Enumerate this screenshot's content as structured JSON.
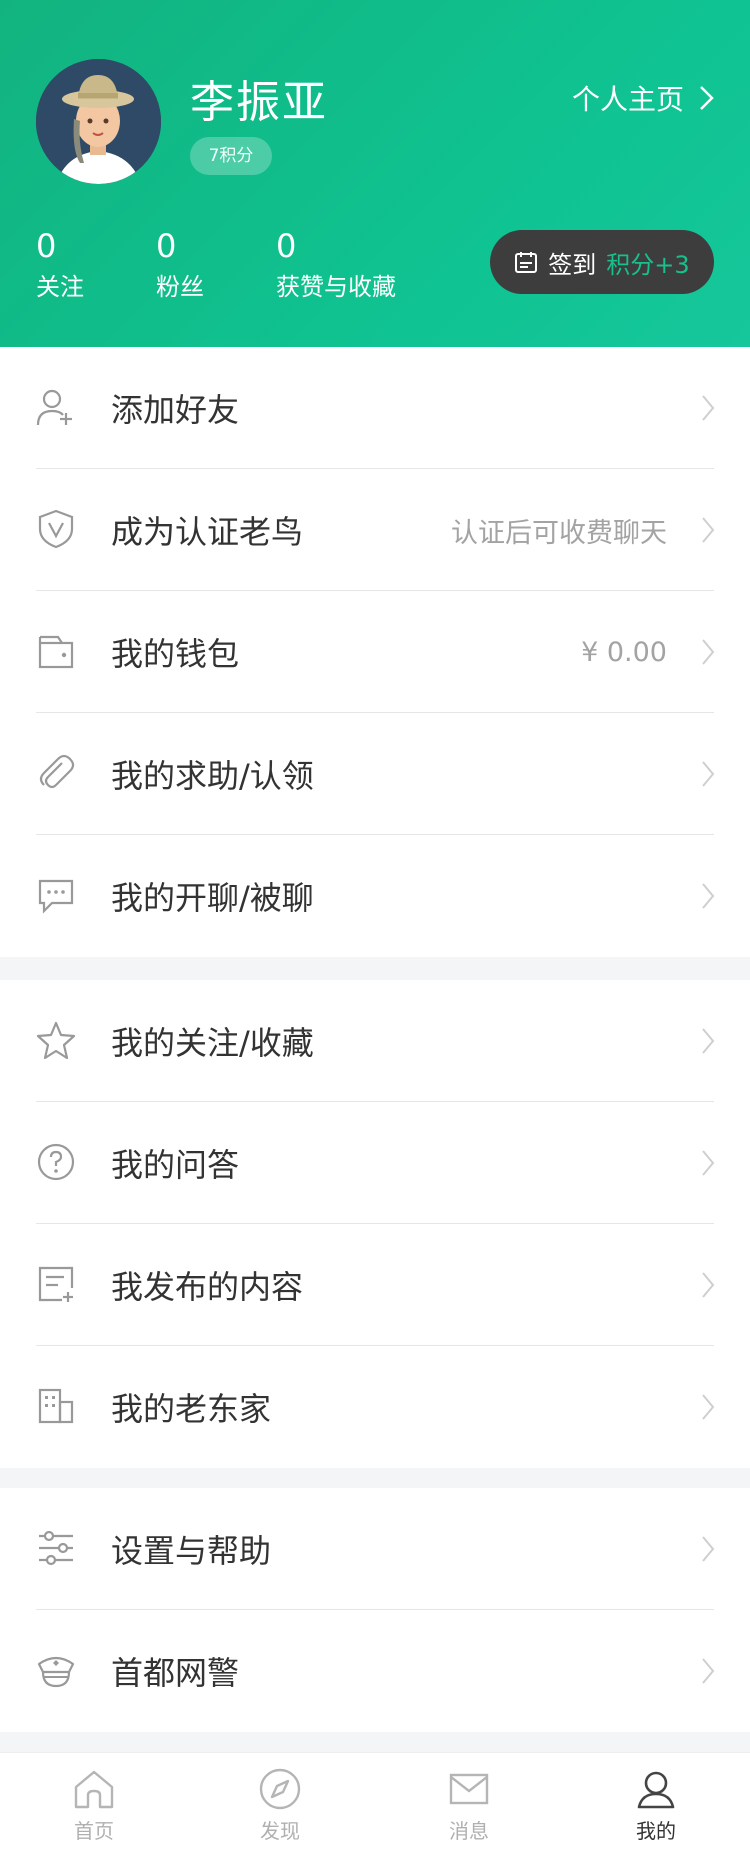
{
  "profile": {
    "name": "李振亚",
    "points_badge": "7积分",
    "homepage_link": "个人主页",
    "stats": [
      {
        "count": "0",
        "label": "关注"
      },
      {
        "count": "0",
        "label": "粉丝"
      },
      {
        "count": "0",
        "label": "获赞与收藏"
      }
    ],
    "checkin": {
      "label": "签到",
      "reward": "积分+3"
    }
  },
  "section1": [
    {
      "icon": "add-user-icon",
      "label": "添加好友",
      "value": ""
    },
    {
      "icon": "verified-shield-icon",
      "label": "成为认证老鸟",
      "value": "认证后可收费聊天"
    },
    {
      "icon": "wallet-icon",
      "label": "我的钱包",
      "value": "¥ 0.00"
    },
    {
      "icon": "paperclip-icon",
      "label": "我的求助/认领",
      "value": ""
    },
    {
      "icon": "chat-bubble-icon",
      "label": "我的开聊/被聊",
      "value": ""
    }
  ],
  "section2": [
    {
      "icon": "star-icon",
      "label": "我的关注/收藏"
    },
    {
      "icon": "question-icon",
      "label": "我的问答"
    },
    {
      "icon": "document-add-icon",
      "label": "我发布的内容"
    },
    {
      "icon": "building-icon",
      "label": "我的老东家"
    }
  ],
  "section3": [
    {
      "icon": "sliders-icon",
      "label": "设置与帮助"
    },
    {
      "icon": "police-cap-icon",
      "label": "首都网警"
    }
  ],
  "tabbar": [
    {
      "icon": "home-icon",
      "label": "首页",
      "active": false
    },
    {
      "icon": "compass-icon",
      "label": "发现",
      "active": false
    },
    {
      "icon": "mail-icon",
      "label": "消息",
      "active": false
    },
    {
      "icon": "user-icon",
      "label": "我的",
      "active": true
    }
  ],
  "colors": {
    "brand": "#12b37f",
    "reward": "#18c08b"
  }
}
